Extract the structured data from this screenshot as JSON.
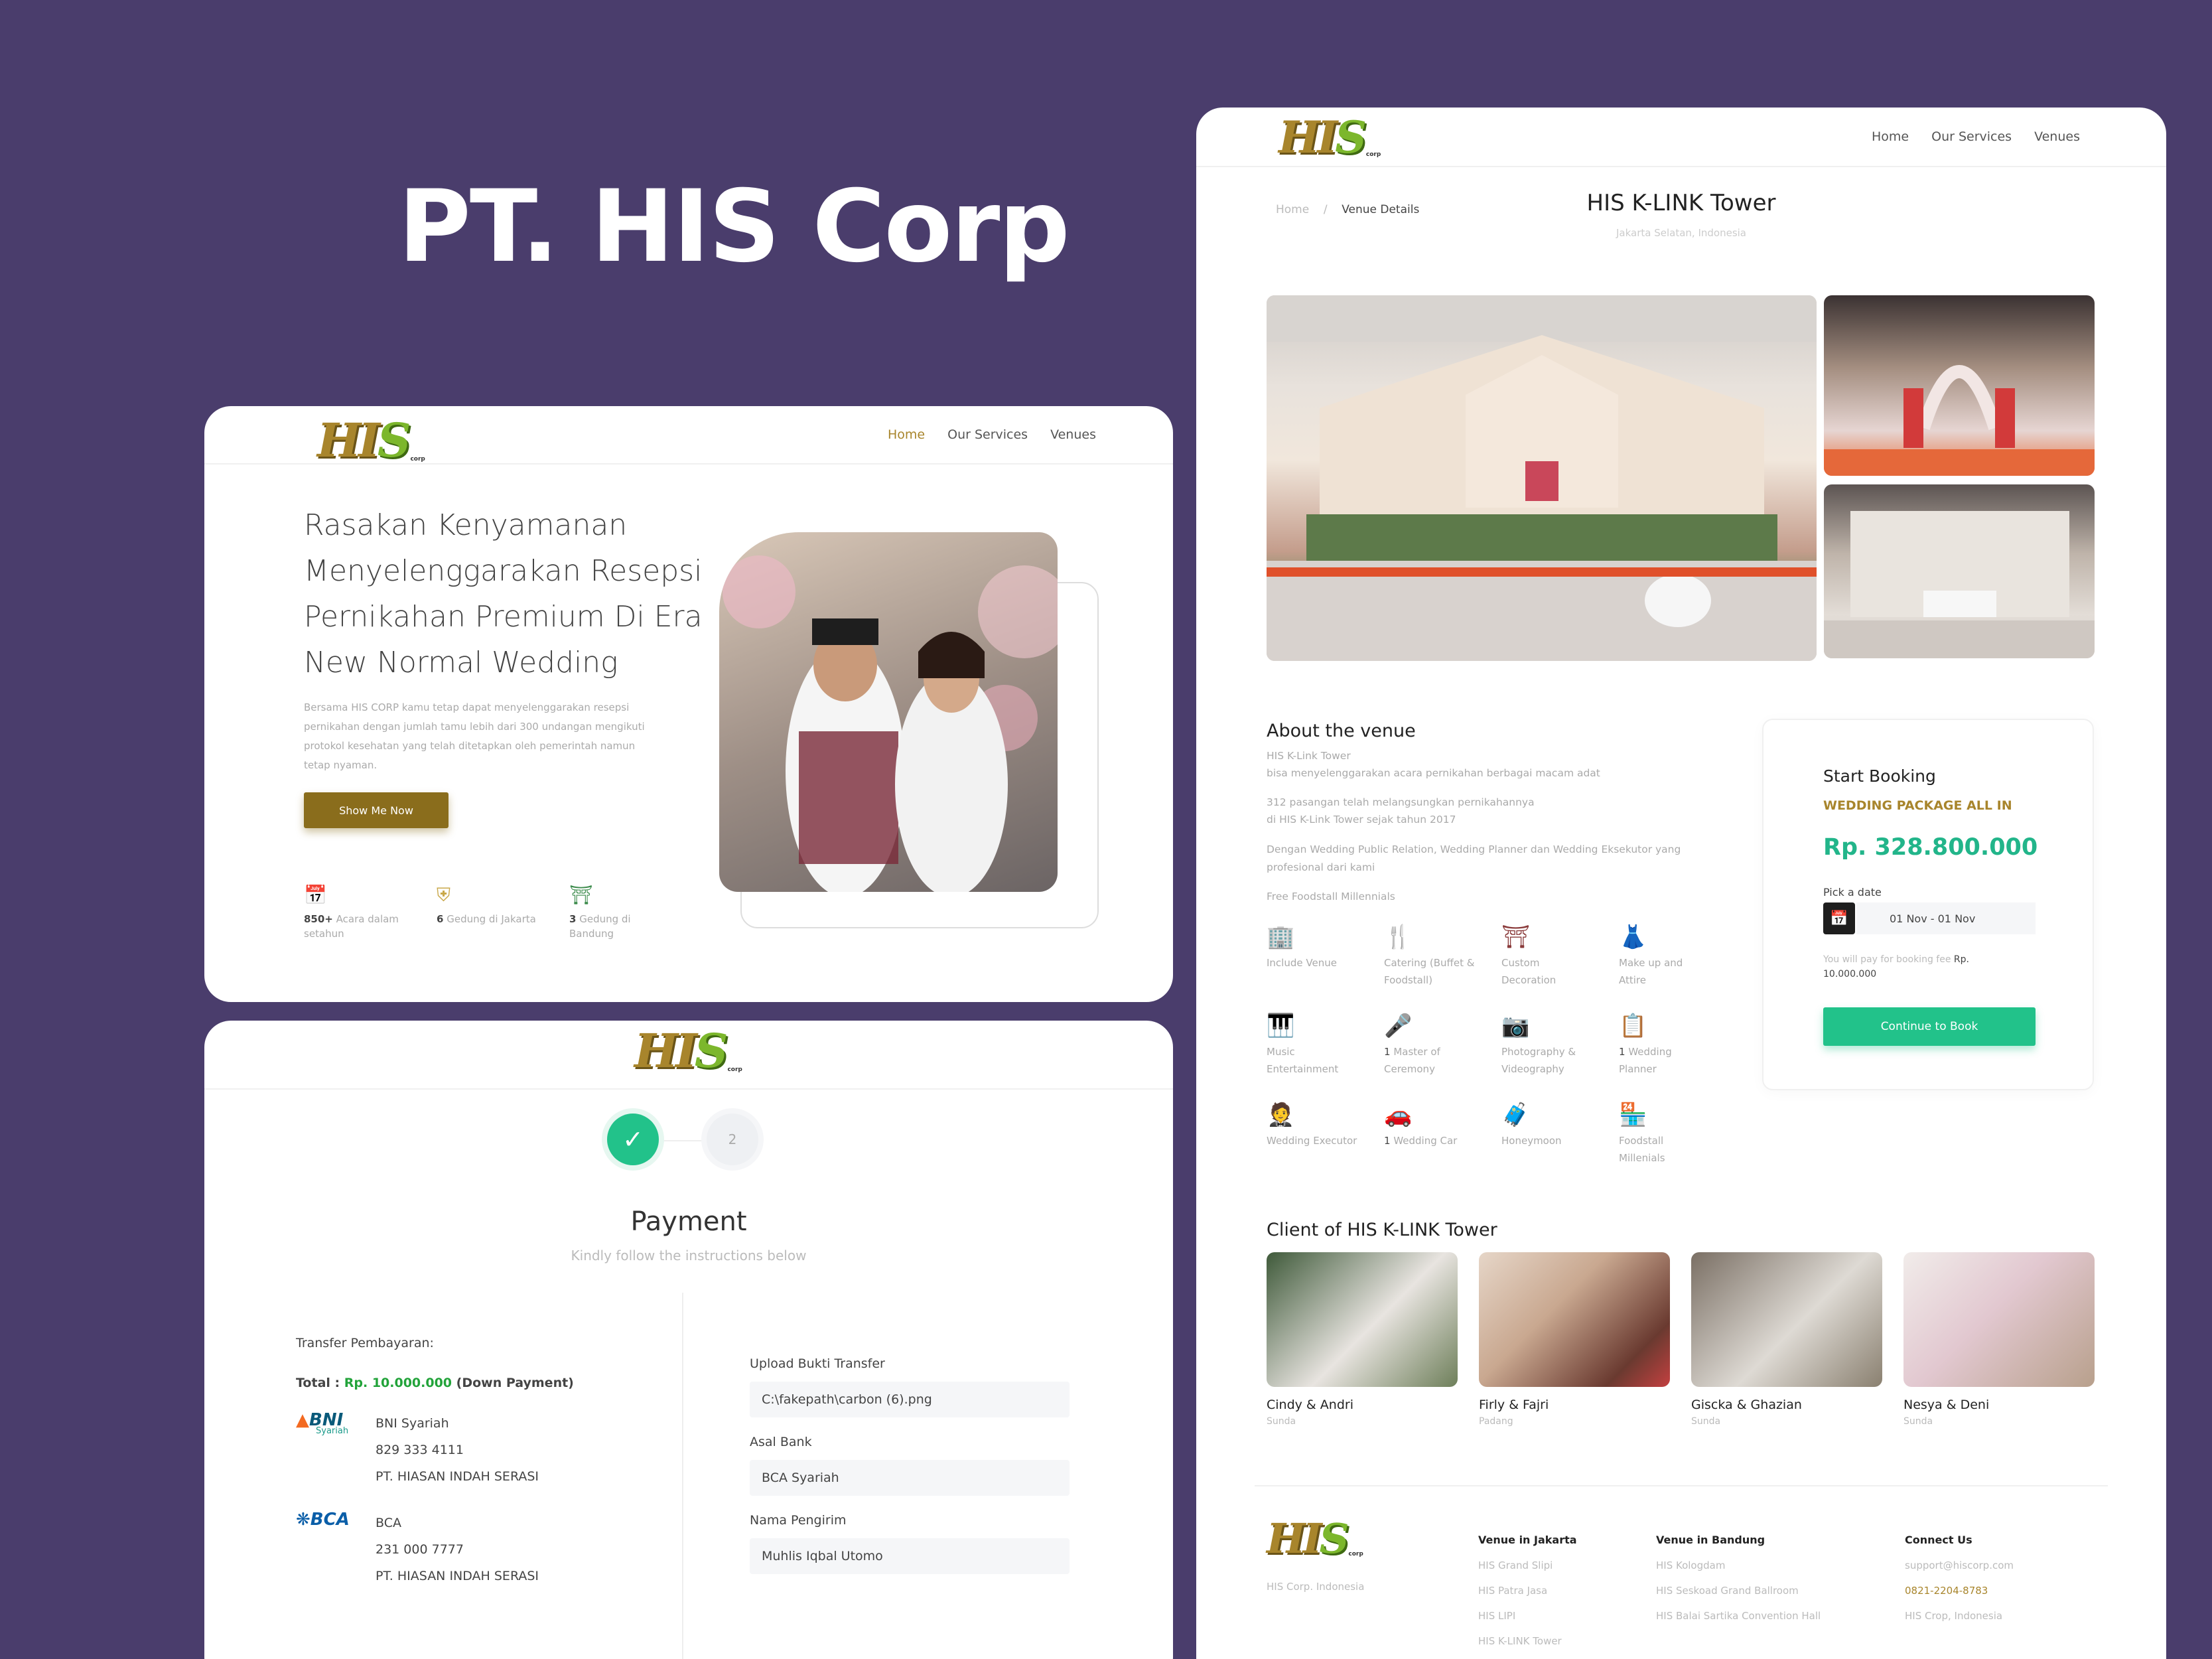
{
  "headline": "PT. HIS Corp",
  "logo": {
    "mark_a": "HI",
    "mark_b": "S",
    "corp": "corp"
  },
  "home": {
    "nav": [
      "Home",
      "Our Services",
      "Venues"
    ],
    "hero_title": "Rasakan Kenyamanan Menyelenggarakan Resepsi Pernikahan Premium Di Era New Normal Wedding",
    "hero_desc": "Bersama HIS CORP kamu tetap dapat menyelenggarakan resepsi pernikahan dengan jumlah tamu lebih dari 300 undangan mengikuti protokol kesehatan yang telah ditetapkan oleh pemerintah namun tetap nyaman.",
    "cta": "Show Me Now",
    "stats": [
      {
        "icon": "calendar-icon",
        "value": "850+",
        "label": "Acara dalam setahun"
      },
      {
        "icon": "monument-icon",
        "value": "6",
        "label": "Gedung di Jakarta"
      },
      {
        "icon": "gedung-sate-icon",
        "value": "3",
        "label": "Gedung di Bandung"
      }
    ]
  },
  "payment": {
    "steps": [
      "✓",
      "2"
    ],
    "title": "Payment",
    "subtitle": "Kindly follow the instructions below",
    "transfer_label": "Transfer Pembayaran:",
    "total_label": "Total :",
    "total_amount": "Rp. 10.000.000",
    "total_note": "(Down Payment)",
    "banks": [
      {
        "logo": "BNI",
        "logo_sub": "Syariah",
        "name": "BNI Syariah",
        "account": "829 333 4111",
        "holder": "PT. HIASAN INDAH SERASI"
      },
      {
        "logo": "BCA",
        "logo_sub": "",
        "name": "BCA",
        "account": "231 000 7777",
        "holder": "PT. HIASAN INDAH SERASI"
      }
    ],
    "fields": [
      {
        "label": "Upload Bukti Transfer",
        "value": "C:\\fakepath\\carbon (6).png"
      },
      {
        "label": "Asal Bank",
        "value": "BCA Syariah"
      },
      {
        "label": "Nama Pengirim",
        "value": "Muhlis Iqbal Utomo"
      }
    ]
  },
  "venue": {
    "nav": [
      "Home",
      "Our Services",
      "Venues"
    ],
    "breadcrumb": {
      "home": "Home",
      "sep": "/",
      "current": "Venue Details"
    },
    "title": "HIS K-LINK Tower",
    "location": "Jakarta Selatan, Indonesia",
    "about_title": "About the venue",
    "about_lines": [
      "HIS K-Link Tower",
      "bisa menyelenggarakan acara pernikahan berbagai macam adat",
      "312 pasangan telah melangsungkan pernikahannya",
      "di HIS K-Link Tower sejak tahun 2017",
      "Dengan Wedding Public Relation, Wedding Planner dan Wedding Eksekutor yang profesional dari kami",
      "Free Foodstall Millennials"
    ],
    "facilities": [
      {
        "icon": "building-icon",
        "count": "",
        "label": "Include Venue"
      },
      {
        "icon": "catering-icon",
        "count": "",
        "label": "Catering (Buffet & Foodstall)"
      },
      {
        "icon": "decoration-icon",
        "count": "",
        "label": "Custom Decoration"
      },
      {
        "icon": "attire-icon",
        "count": "",
        "label": "Make up and Attire"
      },
      {
        "icon": "piano-icon",
        "count": "",
        "label": "Music Entertainment"
      },
      {
        "icon": "microphone-icon",
        "count": "1",
        "label": "Master of Ceremony"
      },
      {
        "icon": "camera-icon",
        "count": "",
        "label": "Photography & Videography"
      },
      {
        "icon": "planner-icon",
        "count": "1",
        "label": "Wedding Planner"
      },
      {
        "icon": "suit-icon",
        "count": "",
        "label": "Wedding Executor"
      },
      {
        "icon": "car-icon",
        "count": "1",
        "label": "Wedding Car"
      },
      {
        "icon": "luggage-icon",
        "count": "",
        "label": "Honeymoon"
      },
      {
        "icon": "foodstall-icon",
        "count": "",
        "label": "Foodstall Millenials"
      }
    ],
    "booking": {
      "title": "Start Booking",
      "package": "WEDDING PACKAGE ALL IN",
      "price": "Rp. 328.800.000",
      "date_label": "Pick a date",
      "date_value": "01 Nov - 01 Nov",
      "fee_text": "You will pay for booking fee",
      "fee_amount": "Rp. 10.000.000",
      "button": "Continue to Book"
    },
    "clients_title": "Client of HIS K-LINK Tower",
    "clients": [
      {
        "name": "Cindy & Andri",
        "origin": "Sunda",
        "c1": "#3f5a3a",
        "c2": "#e8e4e0"
      },
      {
        "name": "Firly & Fajri",
        "origin": "Padang",
        "c1": "#c9a890",
        "c2": "#6a3a30"
      },
      {
        "name": "Giscka & Ghazian",
        "origin": "Sunda",
        "c1": "#7a6f64",
        "c2": "#dedad4"
      },
      {
        "name": "Nesya & Deni",
        "origin": "Sunda",
        "c1": "#f1ecea",
        "c2": "#b8a08c"
      }
    ],
    "footer": {
      "tagline": "HIS Corp. Indonesia",
      "jakarta_title": "Venue in Jakarta",
      "jakarta": [
        "HIS Grand Slipi",
        "HIS Patra Jasa",
        "HIS LIPI",
        "HIS K-LINK Tower"
      ],
      "bandung_title": "Venue in Bandung",
      "bandung": [
        "HIS Kologdam",
        "HIS Seskoad Grand Ballroom",
        "HIS Balai Sartika Convention Hall"
      ],
      "connect_title": "Connect Us",
      "email": "support@hiscorp.com",
      "phone": "0821-2204-8783",
      "address": "HIS Crop, Indonesia"
    }
  }
}
